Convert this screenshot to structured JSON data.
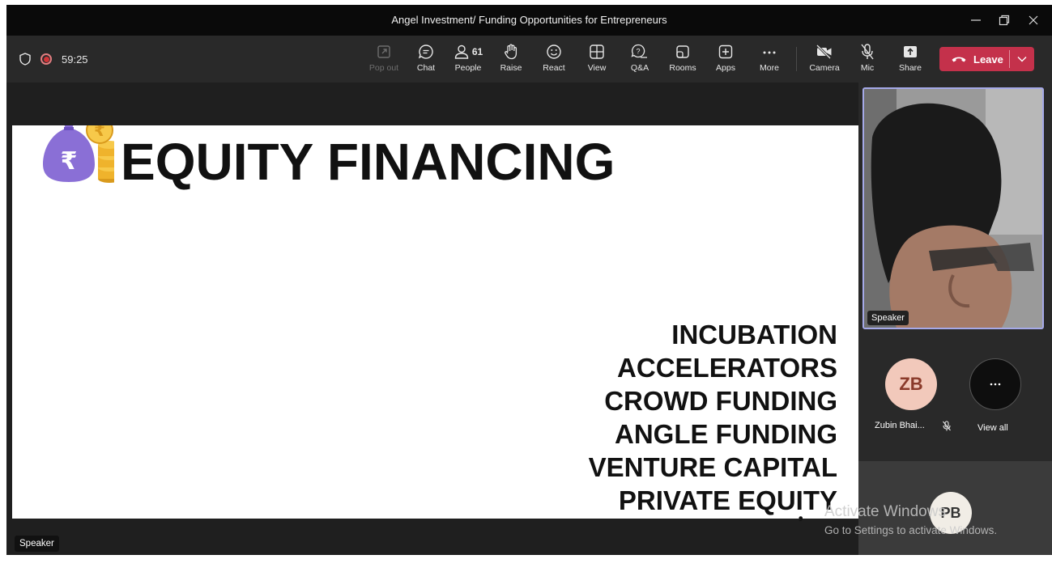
{
  "window": {
    "title": "Angel Investment/ Funding Opportunities for Entrepreneurs",
    "controls": [
      "minimize",
      "restore",
      "close"
    ]
  },
  "toolbar": {
    "timer": "59:25",
    "buttons": [
      {
        "icon": "pop-out-icon",
        "label": "Pop out",
        "enabled": false
      },
      {
        "icon": "chat-icon",
        "label": "Chat"
      },
      {
        "icon": "people-icon",
        "label": "People",
        "count": "61"
      },
      {
        "icon": "raise-hand-icon",
        "label": "Raise"
      },
      {
        "icon": "react-icon",
        "label": "React"
      },
      {
        "icon": "view-icon",
        "label": "View"
      },
      {
        "icon": "qa-icon",
        "label": "Q&A"
      },
      {
        "icon": "rooms-icon",
        "label": "Rooms"
      },
      {
        "icon": "apps-icon",
        "label": "Apps"
      },
      {
        "icon": "more-icon",
        "label": "More"
      },
      {
        "icon": "camera-off-icon",
        "label": "Camera"
      },
      {
        "icon": "mic-off-icon",
        "label": "Mic"
      },
      {
        "icon": "share-icon",
        "label": "Share"
      }
    ],
    "leave_label": "Leave",
    "leave_color": "#c4314b"
  },
  "slide": {
    "title": "EQUITY FINANCING",
    "items": [
      "INCUBATION",
      "ACCELERATORS",
      "CROWD FUNDING",
      "ANGLE FUNDING",
      "VENTURE CAPITAL",
      "PRIVATE EQUITY"
    ],
    "icon": "money-bag-rupee-icon"
  },
  "stage": {
    "speaker_label": "Speaker"
  },
  "participants": {
    "video_label": "Speaker",
    "zb": {
      "initials": "ZB",
      "name": "Zubin Bhai...",
      "muted": true
    },
    "view_all": {
      "icon": "more-icon",
      "label": "View all"
    },
    "pb": {
      "initials": "PB"
    }
  },
  "watermark": {
    "line1": "Activate Windows",
    "line2": "Go to Settings to activate Windows."
  },
  "colors": {
    "accent": "#a5a9e8",
    "recording": "#d13438"
  }
}
